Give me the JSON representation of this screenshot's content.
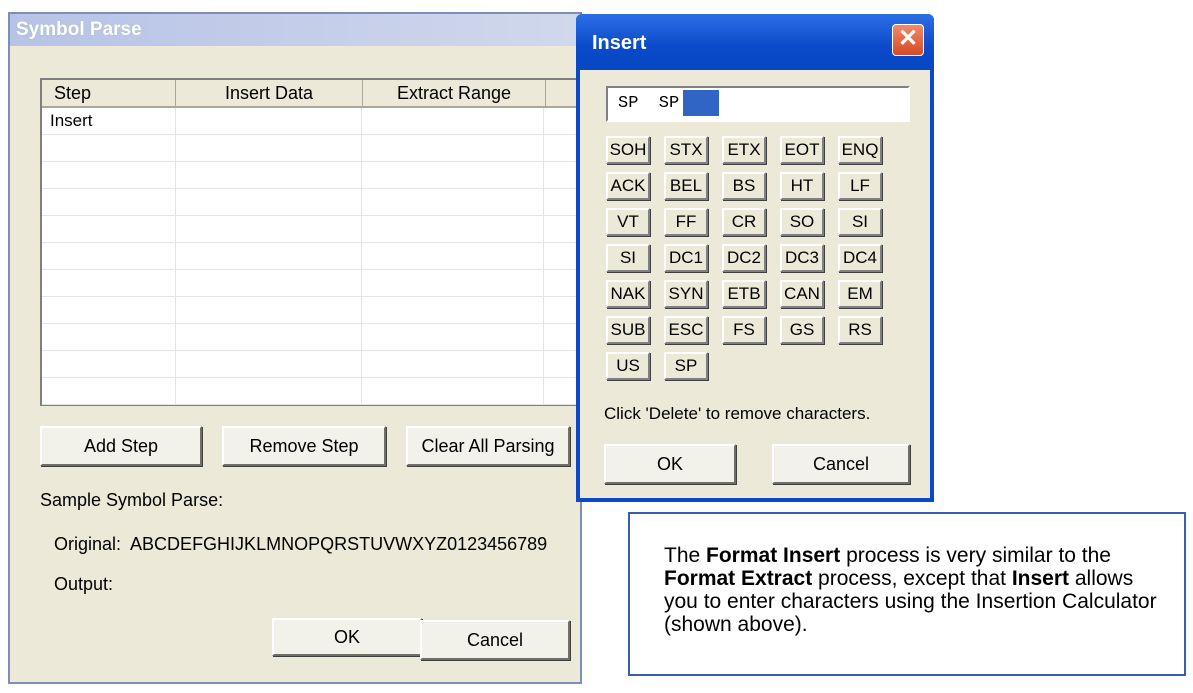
{
  "symbol_parse": {
    "title": "Symbol Parse",
    "columns": [
      "Step",
      "Insert Data",
      "Extract Range",
      ""
    ],
    "rows": [
      [
        "Insert",
        "",
        "",
        ""
      ],
      [
        "",
        "",
        "",
        ""
      ],
      [
        "",
        "",
        "",
        ""
      ],
      [
        "",
        "",
        "",
        ""
      ],
      [
        "",
        "",
        "",
        ""
      ],
      [
        "",
        "",
        "",
        ""
      ],
      [
        "",
        "",
        "",
        ""
      ],
      [
        "",
        "",
        "",
        ""
      ],
      [
        "",
        "",
        "",
        ""
      ],
      [
        "",
        "",
        "",
        ""
      ],
      [
        "",
        "",
        "",
        ""
      ]
    ],
    "buttons": {
      "add_step": "Add Step",
      "remove_step": "Remove Step",
      "clear_all": "Clear All Parsing",
      "ok": "OK",
      "cancel": "Cancel"
    },
    "sample_label": "Sample Symbol Parse:",
    "original_label": "Original:",
    "original_value": "ABCDEFGHIJKLMNOPQRSTUVWXYZ0123456789",
    "output_label": "Output:"
  },
  "insert_dialog": {
    "title": "Insert",
    "close_glyph": "✕",
    "field_value": "SP  SP",
    "keys": [
      [
        "SOH",
        "STX",
        "ETX",
        "EOT",
        "ENQ"
      ],
      [
        "ACK",
        "BEL",
        "BS",
        "HT",
        "LF"
      ],
      [
        "VT",
        "FF",
        "CR",
        "SO",
        "SI"
      ],
      [
        "SI",
        "DC1",
        "DC2",
        "DC3",
        "DC4"
      ],
      [
        "NAK",
        "SYN",
        "ETB",
        "CAN",
        "EM"
      ],
      [
        "SUB",
        "ESC",
        "FS",
        "GS",
        "RS"
      ],
      [
        "US",
        "SP"
      ]
    ],
    "hint": "Click 'Delete' to remove characters.",
    "ok": "OK",
    "cancel": "Cancel"
  },
  "callout": {
    "p1": "The ",
    "b1": "Format Insert",
    "p2": " process is very similar to the ",
    "b2": "Format Extract",
    "p3": " process, except that ",
    "b3": "Insert",
    "p4": " allows you to enter characters using the Insertion Calculator (shown above)."
  },
  "colors": {
    "dialog_bg": "#ece9d8",
    "insert_titlebar": "#0a49c8",
    "close_button": "#d44a25",
    "cursor_block": "#3165c5",
    "callout_border": "#3a5faa"
  },
  "icons": {
    "close": "close-icon"
  }
}
